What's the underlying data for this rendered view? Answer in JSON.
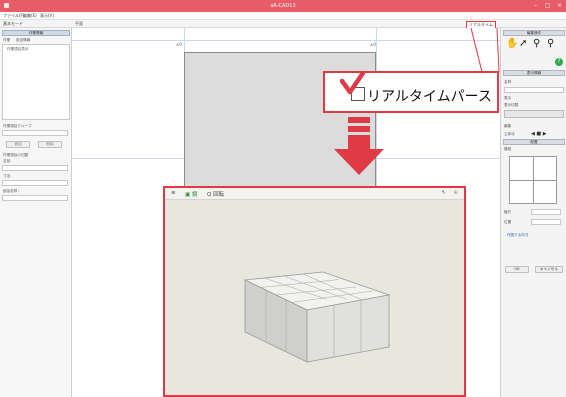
{
  "window": {
    "title": "aR-CAD13"
  },
  "menubar": {
    "items": [
      "ファイル(F)",
      "編集(E)",
      "表示(V)"
    ]
  },
  "toolbar2": {
    "left_label": "基本モード",
    "tab_label": "平面",
    "realtime_label": "リアルタイム"
  },
  "left_panel": {
    "header": "作業情報",
    "tabs": [
      "作業",
      "設定情報"
    ],
    "checkbox_label": "作業項目表示",
    "section_label": "作業項目グループ",
    "buttons": [
      "追加",
      "削除"
    ],
    "fields": [
      "作業項目の切替",
      "名前：",
      "寸法：",
      "部品名称："
    ]
  },
  "canvas": {
    "dim_left": "±0",
    "dim_right": "±0",
    "view_tab": "平面"
  },
  "right_panel": {
    "header_edit": "編集操作",
    "header_display": "表示情報",
    "labels": [
      "名称",
      "表示",
      "表示切替",
      "編集",
      "立体化",
      "配置",
      "階段",
      "縮尺",
      "位置",
      "作図する向き"
    ],
    "buttons": [
      "OK",
      "キャンセル"
    ],
    "help_icon": "?"
  },
  "callout": {
    "checkbox_label": "リアルタイムパース",
    "checked": false
  },
  "viewer": {
    "toolbar_items": [
      "≡",
      "▣ 鏡",
      "Q 回転"
    ]
  },
  "colors": {
    "accent": "#e03a47",
    "titlebar": "#e85c68",
    "box_top": "#f2f2f0"
  }
}
